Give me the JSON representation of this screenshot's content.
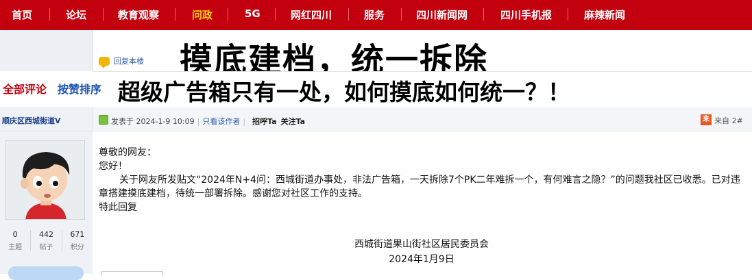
{
  "nav": {
    "items": [
      {
        "label": "首页"
      },
      {
        "label": "论坛"
      },
      {
        "label": "教育观察"
      },
      {
        "label": "问政"
      },
      {
        "label": "5G"
      },
      {
        "label": "网红四川"
      },
      {
        "label": "服务"
      },
      {
        "label": "四川新闻网"
      },
      {
        "label": "四川手机报"
      },
      {
        "label": "麻辣新闻"
      }
    ],
    "active_color": "#ffd200",
    "bg_color": "#c3000d"
  },
  "reply_link": "回复本楼",
  "headline1": "摸底建档，统一拆除",
  "tabs": {
    "all_comments": "全部评论",
    "by_likes": "按赞排序"
  },
  "headline2": "超级广告箱只有一处，如何摸底如何统一？！",
  "user": {
    "name": "顺庆区西城街道V",
    "stats": [
      {
        "value": "0",
        "label": "主题"
      },
      {
        "value": "442",
        "label": "帖子"
      },
      {
        "value": "671",
        "label": "积分"
      }
    ]
  },
  "post": {
    "posted_at": "发表于 2024-1-9 10:09",
    "only_author": "只看该作者",
    "greet": "招呼Ta",
    "follow": "关注Ta",
    "from_icon": "来",
    "from_text": "来自 2#",
    "body": {
      "salutation": "尊敬的网友：",
      "hello": "您好！",
      "paragraph": "关于网友所发贴文“2024年N+4问：西城街道办事处，非法广告箱，一天拆除7个PK二年难拆一个，有何难言之隐？”的问题我社区已收悉。已对违章搭建摸底建档，待统一部署拆除。感谢您对社区工作的支持。",
      "closing": "特此回复"
    },
    "signature": {
      "org": "西城街道果山街社区居民委员会",
      "date": "2024年1月9日"
    }
  }
}
